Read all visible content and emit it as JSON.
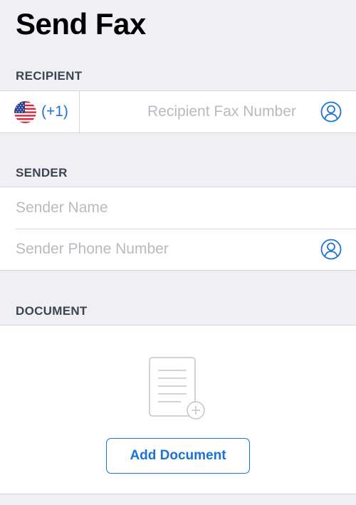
{
  "page": {
    "title": "Send Fax"
  },
  "recipient": {
    "header": "RECIPIENT",
    "country_code": "(+1)",
    "fax_placeholder": "Recipient Fax Number"
  },
  "sender": {
    "header": "SENDER",
    "name_placeholder": "Sender Name",
    "phone_placeholder": "Sender Phone Number"
  },
  "document": {
    "header": "DOCUMENT",
    "add_button_label": "Add Document"
  },
  "icons": {
    "country_flag": "us-flag-icon",
    "recipient_contact": "contact-person-icon",
    "sender_contact": "contact-person-icon",
    "document": "document-add-icon"
  },
  "colors": {
    "accent": "#1a73d9",
    "background": "#f0f0f4",
    "placeholder": "#b9bac0",
    "section_header": "#3c4452"
  }
}
